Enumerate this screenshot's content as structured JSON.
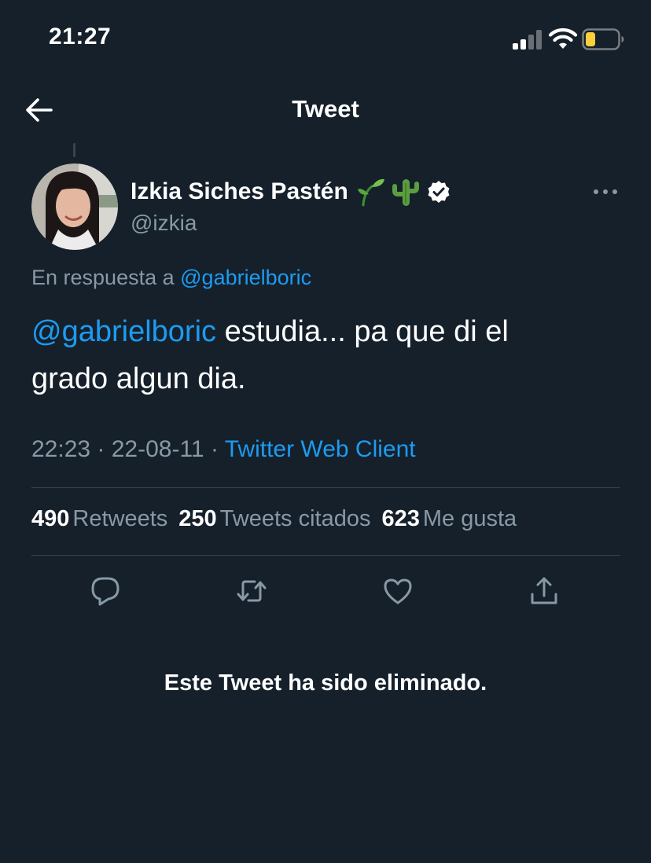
{
  "status_bar": {
    "time": "21:27",
    "signal_icon": "cellular-signal-icon",
    "wifi_icon": "wifi-icon",
    "battery_icon": "battery-icon",
    "battery_level": 0.3,
    "battery_color": "#f7d03c"
  },
  "header": {
    "back_icon": "arrow-left-icon",
    "title": "Tweet"
  },
  "author": {
    "name": "Izkia Siches Pastén",
    "emojis": [
      "seedling-emoji",
      "cactus-emoji"
    ],
    "verified_icon": "verified-badge-icon",
    "handle": "@izkia",
    "more_icon": "more-options-icon"
  },
  "reply_to": {
    "prefix": "En respuesta a",
    "mention": "@gabrielboric"
  },
  "tweet": {
    "mention": "@gabrielboric",
    "text_line1": " estudia... pa que di el",
    "text_line2": "grado algun dia."
  },
  "meta": {
    "time": "22:23",
    "separator": " · ",
    "date": "22-08-11",
    "separator2": " · ",
    "source": "Twitter Web Client"
  },
  "stats": {
    "retweets_count": "490",
    "retweets_label": "Retweets",
    "quotes_count": "250",
    "quotes_label": "Tweets citados",
    "likes_count": "623",
    "likes_label": "Me gusta"
  },
  "actions": {
    "reply_icon": "reply-icon",
    "retweet_icon": "retweet-icon",
    "like_icon": "heart-icon",
    "share_icon": "share-icon"
  },
  "notice": {
    "deleted_text": "Este Tweet ha sido eliminado."
  },
  "colors": {
    "background": "#15202b",
    "accent": "#1d9bf0",
    "secondary_text": "#8899a6",
    "divider": "#38444d"
  }
}
